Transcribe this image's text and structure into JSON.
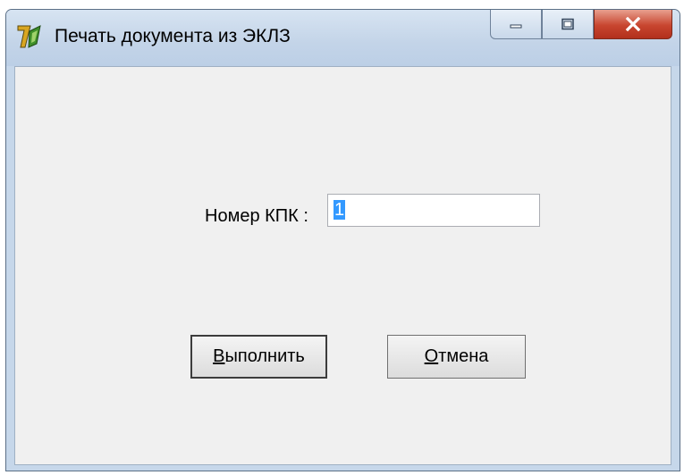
{
  "window": {
    "title": "Печать документа из ЭКЛЗ",
    "controls": {
      "minimize": "minimize",
      "maximize": "maximize",
      "close": "close"
    }
  },
  "form": {
    "kpk_label": "Номер КПК :",
    "kpk_value": "1"
  },
  "buttons": {
    "execute": {
      "hotkey": "В",
      "rest": "ыполнить"
    },
    "cancel": {
      "hotkey": "О",
      "rest": "тмена"
    }
  },
  "colors": {
    "selection": "#3399ff",
    "close_button": "#c8452f",
    "client_bg": "#f0f0f0"
  }
}
